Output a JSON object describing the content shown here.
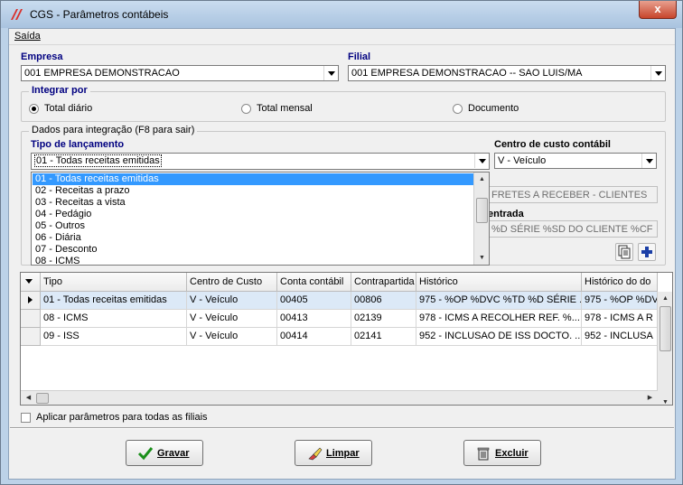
{
  "window": {
    "title": "CGS - Parâmetros contábeis",
    "close_glyph": "x"
  },
  "menu": {
    "saida": "Saída"
  },
  "empresa": {
    "label": "Empresa",
    "value": "001 EMPRESA DEMONSTRACAO"
  },
  "filial": {
    "label": "Filial",
    "value": "001 EMPRESA DEMONSTRACAO -- SAO LUIS/MA"
  },
  "integrar": {
    "title": "Integrar por",
    "options": [
      "Total diário",
      "Total mensal",
      "Documento"
    ],
    "selected": "Total diário"
  },
  "dados": {
    "title": "Dados para integração  (F8 para sair)",
    "tipo_label": "Tipo de lançamento",
    "tipo_value": "01 - Todas receitas emitidas",
    "tipo_options": [
      "01 - Todas receitas emitidas",
      "02 - Receitas a prazo",
      "03 - Receitas a vista",
      "04 - Pedágio",
      "05 - Outros",
      "06 - Diária",
      "07 - Desconto",
      "08 - ICMS"
    ],
    "centro_label": "Centro de custo contábil",
    "centro_value": "V - Veículo",
    "conta_field": "FRETES A RECEBER - CLIENTES",
    "entrada_label": "entrada",
    "historico_field": "%D SÉRIE %SD DO CLIENTE %CF"
  },
  "grid": {
    "columns": [
      "Tipo",
      "Centro de Custo",
      "Conta contábil",
      "Contrapartida",
      "Histórico",
      "Histórico do do"
    ],
    "rows": [
      [
        "01 - Todas receitas emitidas",
        "V - Veículo",
        "00405",
        "00806",
        "975 - %OP %DVC %TD %D SÉRIE ...",
        "975 - %OP %DV"
      ],
      [
        "08 - ICMS",
        "V - Veículo",
        "00413",
        "02139",
        "978 - ICMS A RECOLHER REF. %...",
        "978 - ICMS A R"
      ],
      [
        "09 - ISS",
        "V - Veículo",
        "00414",
        "02141",
        "952 - INCLUSAO DE ISS DOCTO. ...",
        "952 - INCLUSA"
      ]
    ],
    "selected_row": 0
  },
  "aplicar": {
    "label": "Aplicar parâmetros para todas as filiais",
    "checked": false
  },
  "buttons": {
    "gravar": "Gravar",
    "limpar": "Limpar",
    "excluir": "Excluir"
  },
  "colors": {
    "selection": "#3399ff",
    "label_blue": "#000080",
    "row_highlight": "#dce9f7"
  }
}
